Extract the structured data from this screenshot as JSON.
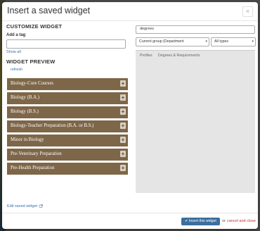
{
  "dialog": {
    "title": "Insert a saved widget",
    "close_label": "×"
  },
  "customize": {
    "heading": "CUSTOMIZE WIDGET",
    "tag_label": "Add a tag",
    "tag_value": "",
    "show_all": "Show all"
  },
  "preview": {
    "heading": "WIDGET PREVIEW",
    "refresh": "refresh",
    "items": [
      {
        "label": "Biology-Core Courses"
      },
      {
        "label": "Biology (B.A.)"
      },
      {
        "label": "Biology (B.S.)"
      },
      {
        "label": "Biology-Teacher Preparation (B.A. or B.S.)"
      },
      {
        "label": "Minor in Biology"
      },
      {
        "label": "Pre-Veterinary Preparation"
      },
      {
        "label": "Pre-Health Preparation"
      }
    ],
    "plus_label": "+",
    "edit_link": "Edit saved widget"
  },
  "search": {
    "value": "degrees",
    "group_select": "Current group (Department",
    "type_select": "All types",
    "result_tabs": [
      "Profiles",
      "Degrees & Requirements"
    ]
  },
  "footer": {
    "insert_label": "✔ Insert this widget",
    "or_text": "or",
    "cancel_label": "cancel and close"
  },
  "colors": {
    "widget_bg": "#7e6648",
    "primary": "#3c6e9e",
    "cancel": "#c9302c",
    "link": "#3a6ea8"
  }
}
